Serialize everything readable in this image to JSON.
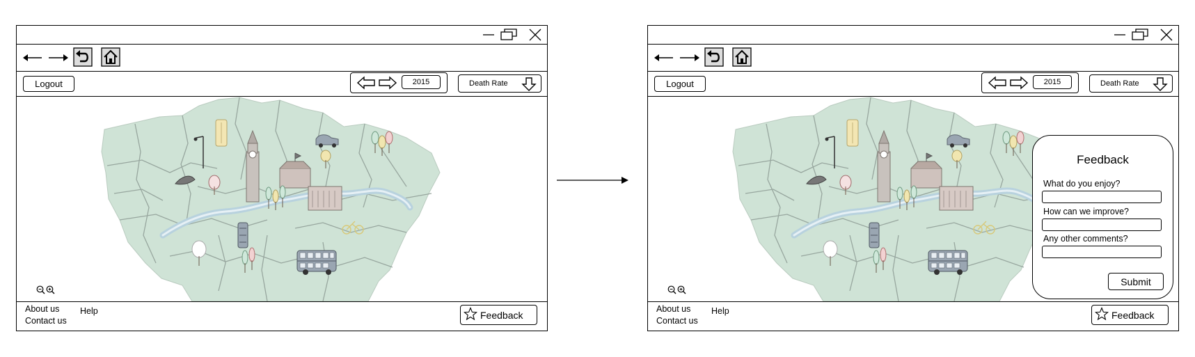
{
  "toolbar": {
    "logout_label": "Logout",
    "year": "2015",
    "metric": "Death Rate"
  },
  "footer": {
    "about": "About us",
    "contact": "Contact us",
    "help": "Help",
    "feedback_label": "Feedback"
  },
  "feedback_panel": {
    "title": "Feedback",
    "q1": "What do you enjoy?",
    "q2": "How can we improve?",
    "q3": "Any other comments?",
    "submit_label": "Submit"
  },
  "icons": {
    "minimize": "minimize-icon",
    "restore": "restore-icon",
    "close": "close-icon",
    "back": "arrow-left-icon",
    "forward": "arrow-right-icon",
    "refresh": "refresh-icon",
    "home": "home-icon",
    "prev_year": "prev-arrow-icon",
    "next_year": "next-arrow-icon",
    "dropdown": "dropdown-arrow-icon",
    "zoom_out": "zoom-out-icon",
    "zoom_in": "zoom-in-icon",
    "star": "star-icon"
  },
  "colors": {
    "map_land": "#cfe3d6",
    "map_river": "#b8d2de",
    "map_border": "#8e9c95"
  }
}
